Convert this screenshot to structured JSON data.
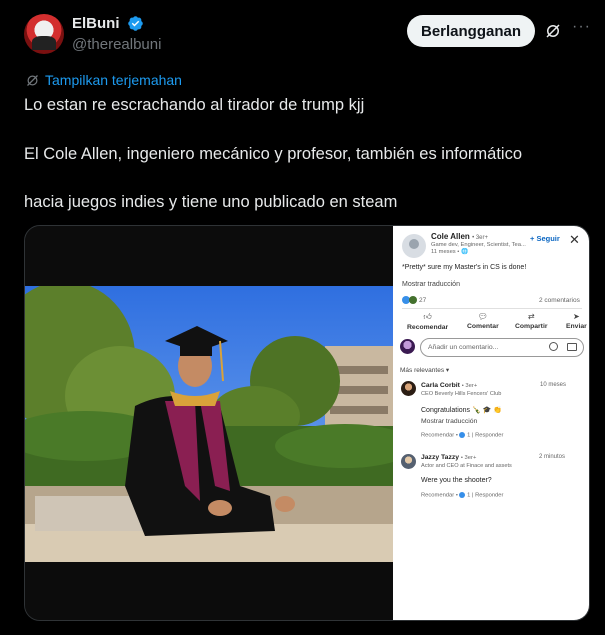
{
  "header": {
    "display_name": "ElBuni",
    "handle": "@therealbuni",
    "subscribe_label": "Berlangganan"
  },
  "translate_label": "Tampilkan terjemahan",
  "tweet_lines": [
    "Lo estan re escrachando al tirador de trump kjj",
    "El Cole Allen, ingeniero mecánico y profesor, también es informático",
    "hacia juegos indies y tiene uno publicado en steam"
  ],
  "linkedin": {
    "author": "Cole Allen",
    "degree": "• 3er+",
    "headline": "Game dev, Engineer, Scientist, Tea...",
    "time": "11 meses • ",
    "follow_label": "+ Seguir",
    "post_text": "*Pretty* sure my Master's in CS is done!",
    "translate_label": "Mostrar traducción",
    "reaction_count": "27",
    "comments_count": "2 comentarios",
    "actions": [
      "Recomendar",
      "Comentar",
      "Compartir",
      "Enviar"
    ],
    "comment_placeholder": "Añadir un comentario...",
    "relevance_label": "Más relevantes ▾",
    "comments": [
      {
        "name": "Carla Corbit",
        "degree": "• 3er+",
        "headline": "CEO Beverly Hills Fencers' Club",
        "time": "10 meses",
        "text": "Congratulations 🍾 🎓 👏",
        "translate": "Mostrar traducción",
        "like": "Recomendar",
        "count": "1",
        "reply": "Responder"
      },
      {
        "name": "Jazzy Tazzy",
        "degree": "• 3er+",
        "headline": "Actor and CEO at Finace and assets",
        "time": "2 minutos",
        "text": "Were you the shooter?",
        "like": "Recomendar",
        "count": "1",
        "reply": "Responder"
      }
    ]
  },
  "colors": {
    "accent": "#1d9bf0",
    "linkedin_blue": "#0a66c2",
    "background": "#000000"
  }
}
